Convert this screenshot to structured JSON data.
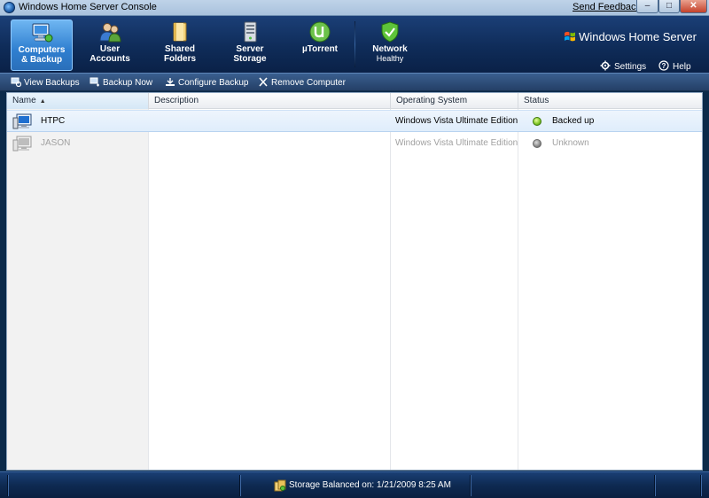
{
  "window": {
    "title": "Windows Home Server Console",
    "send_feedback": "Send Feedback",
    "min": "–",
    "max": "□",
    "close": "✕"
  },
  "nav": {
    "tabs": [
      {
        "line1": "Computers",
        "line2": "& Backup",
        "icon": "computer-icon",
        "active": true
      },
      {
        "line1": "User",
        "line2": "Accounts",
        "icon": "users-icon",
        "active": false
      },
      {
        "line1": "Shared",
        "line2": "Folders",
        "icon": "folder-icon",
        "active": false
      },
      {
        "line1": "Server",
        "line2": "Storage",
        "icon": "server-icon",
        "active": false
      },
      {
        "line1": "µTorrent",
        "line2": "",
        "icon": "utorrent-icon",
        "active": false
      }
    ],
    "network": {
      "label": "Network",
      "status": "Healthy",
      "icon": "shield-check-icon"
    },
    "logo_text": "Windows Home Server",
    "settings": "Settings",
    "help": "Help"
  },
  "toolbar": {
    "view_backups": "View Backups",
    "backup_now": "Backup Now",
    "configure_backup": "Configure Backup",
    "remove_computer": "Remove Computer"
  },
  "grid": {
    "columns": {
      "name": "Name",
      "description": "Description",
      "os": "Operating System",
      "status": "Status"
    },
    "rows": [
      {
        "name": "HTPC",
        "description": "",
        "os": "Windows Vista Ultimate Edition",
        "status": "Backed up",
        "state": "ok"
      },
      {
        "name": "JASON",
        "description": "",
        "os": "Windows Vista Ultimate Edition",
        "status": "Unknown",
        "state": "unknown"
      }
    ]
  },
  "statusbar": {
    "text": "Storage Balanced on: 1/21/2009 8:25 AM"
  },
  "colors": {
    "header_dark": "#0f2c59",
    "active_tab": "#2f7fd0",
    "status_ok": "#7cc324",
    "status_unknown": "#8a8a8a"
  }
}
